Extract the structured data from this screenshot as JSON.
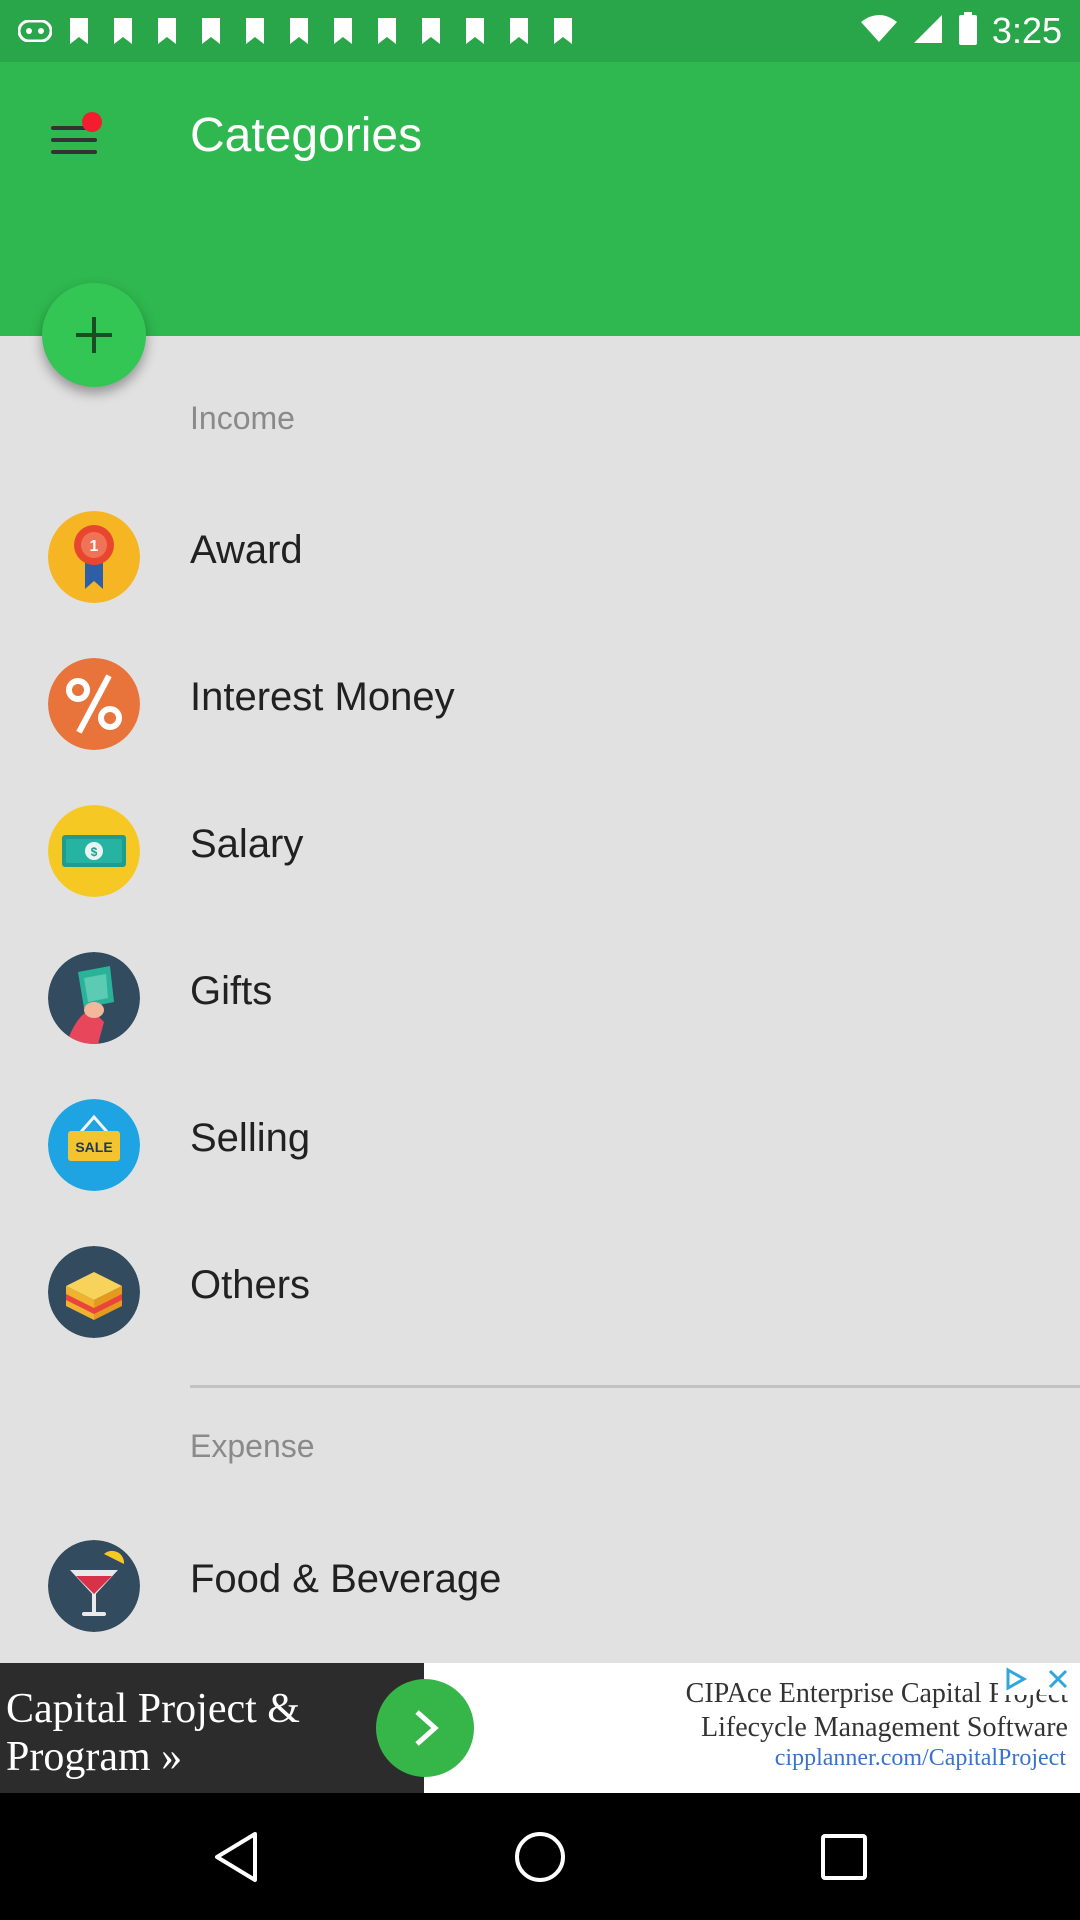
{
  "status_bar": {
    "time": "3:25",
    "notification_icons": [
      "notification-icon",
      "notification-icon",
      "notification-icon",
      "notification-icon",
      "notification-icon",
      "notification-icon",
      "notification-icon",
      "notification-icon",
      "notification-icon",
      "notification-icon",
      "notification-icon",
      "notification-icon",
      "notification-icon"
    ],
    "status_icons": [
      "wifi-icon",
      "signal-icon",
      "battery-icon"
    ]
  },
  "header": {
    "title": "Categories",
    "menu_icon": "menu-icon",
    "has_notification": true,
    "accent_color": "#2fb84f"
  },
  "fab": {
    "icon": "plus-icon"
  },
  "income": {
    "title": "Income",
    "items": [
      {
        "label": "Award",
        "icon": "award-icon"
      },
      {
        "label": "Interest Money",
        "icon": "percent-icon"
      },
      {
        "label": "Salary",
        "icon": "cash-icon"
      },
      {
        "label": "Gifts",
        "icon": "gift-money-icon"
      },
      {
        "label": "Selling",
        "icon": "sale-tag-icon"
      },
      {
        "label": "Others",
        "icon": "box-icon"
      }
    ]
  },
  "expense": {
    "title": "Expense",
    "items": [
      {
        "label": "Food & Beverage",
        "icon": "cocktail-icon"
      }
    ]
  },
  "ad": {
    "headline_line1": "Capital Project &",
    "headline_line2": "Program »",
    "body_line1": "CIPAce Enterprise Capital Project",
    "body_line2": "Lifecycle Management Software",
    "url": "cipplanner.com/CapitalProject"
  },
  "nav": {
    "back": "back-icon",
    "home": "home-icon",
    "recents": "recents-icon"
  }
}
